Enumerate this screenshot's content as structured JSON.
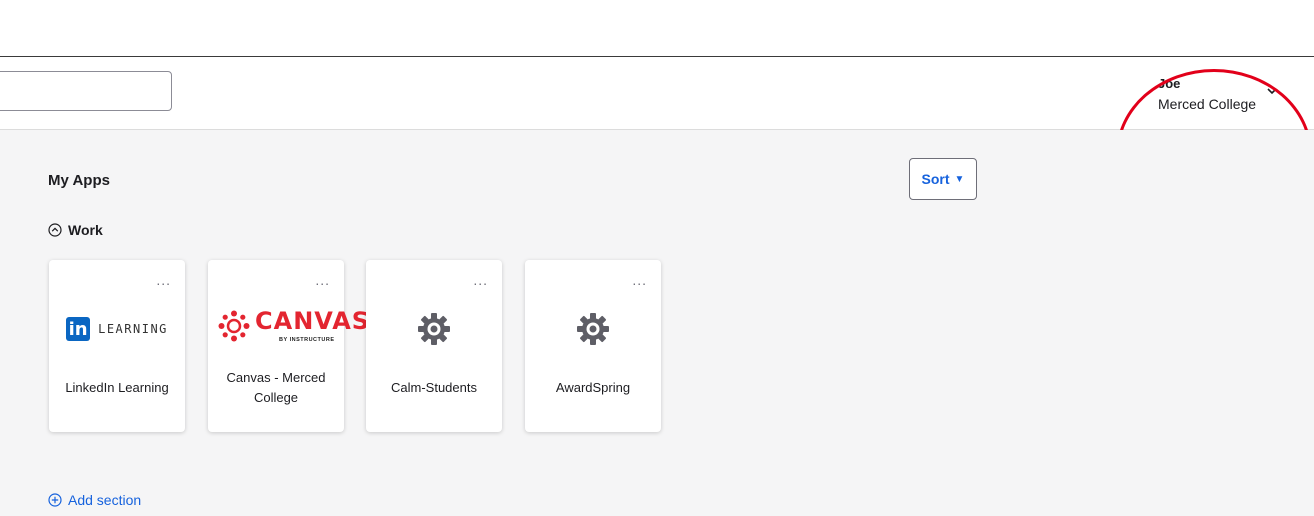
{
  "header": {
    "search": {
      "placeholder": "",
      "value": ""
    },
    "user": {
      "name": "Joe",
      "organization": "Merced College"
    }
  },
  "main": {
    "title": "My Apps",
    "sort_label": "Sort",
    "sections": [
      {
        "title": "Work",
        "apps": [
          {
            "label": "LinkedIn Learning",
            "logo": "linkedin-learning-logo",
            "logo_text": "LEARNING",
            "menu": "..."
          },
          {
            "label": "Canvas - Merced College",
            "logo": "canvas-logo",
            "logo_text": "CANVAS",
            "logo_subtext": "BY INSTRUCTURE",
            "menu": "..."
          },
          {
            "label": "Calm-Students",
            "logo": "gear-icon",
            "menu": "..."
          },
          {
            "label": "AwardSpring",
            "logo": "gear-icon",
            "menu": "..."
          }
        ]
      }
    ],
    "add_section_label": "Add section"
  },
  "colors": {
    "accent": "#1662dd",
    "annotation": "#e2001a",
    "linkedin": "#0a66c2",
    "canvas": "#e32530"
  }
}
